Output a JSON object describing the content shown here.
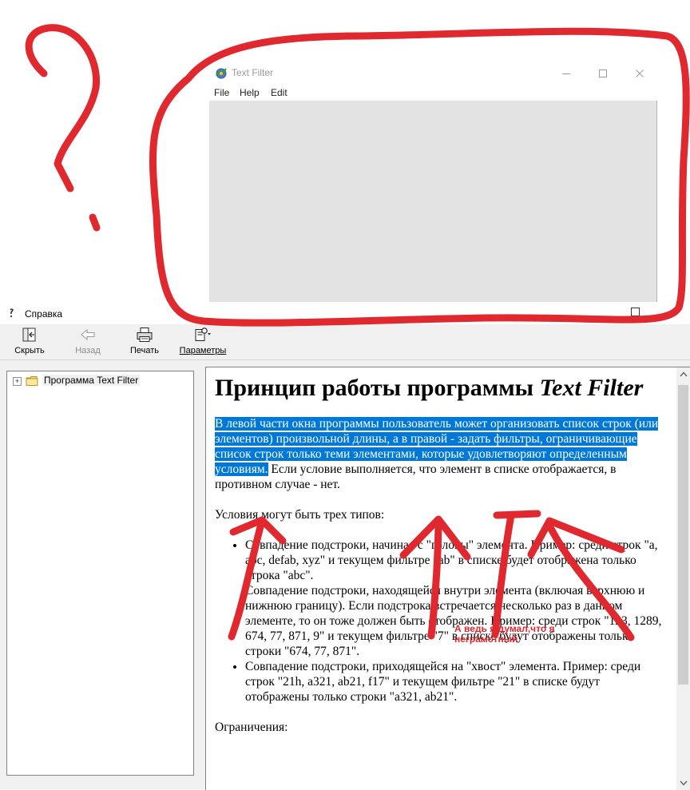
{
  "text_filter_window": {
    "title": "Text Filter",
    "icon": "app-gear-icon",
    "controls": [
      "minimize-icon",
      "maximize-icon",
      "close-icon"
    ],
    "menu": [
      "File",
      "Help",
      "Edit"
    ]
  },
  "help_window": {
    "title": "Справка",
    "toolbar": {
      "hide": "Скрыть",
      "back": "Назад",
      "print": "Печать",
      "options": "Параметры"
    },
    "tree": {
      "expander": "+",
      "item": "Программа Text Filter"
    },
    "content": {
      "heading_plain": "Принцип работы программы ",
      "heading_italic": "Text Filter",
      "p1_selected": "В левой части окна программы пользователь может организовать список строк (или элементов) произвольной длины, а в правой - задать фильтры, ограничивающие список строк только теми элементами, которые удовлетворяют определенным условиям.",
      "p1_rest": " Если условие выполняется, что элемент в списке отображается, в противном случае - нет.",
      "p2": "Условия могут быть трех типов:",
      "li1_a": "Совпадение подстроки, начиная с \"головы\" элемента. Пример: среди строк \"a, abc, defab, xyz\" и текущем фильтре \"ab\" в списке будет отображена только строка \"abc\".",
      "li1_b": "Совпадение подстроки, находящейся внутри элемента (включая верхнюю и нижнюю границу). Если подстрока встречается несколько раз в данном элементе, то он тоже должен быть отображен. Пример: среди строк \"123, 1289, 674, 77, 871, 9\" и текущем фильтре \"7\" в списке будут отображены только строки \"674, 77, 871\".",
      "li2": "Совпадение подстроки, приходящейся на \"хвост\" элемента. Пример: среди строк \"21h, a321, ab21, f17\" и текущем фильтре \"21\" в списке будут отображены только строки \"a321, ab21\".",
      "p3": "Ограничения:"
    }
  },
  "annotation": {
    "text": "А ведь я думал,что я неграмотный",
    "color": "#e0282f"
  },
  "colors": {
    "selection": "#0078d7",
    "annotation_red": "#e0282f",
    "client_area": "#e3e3e3"
  }
}
